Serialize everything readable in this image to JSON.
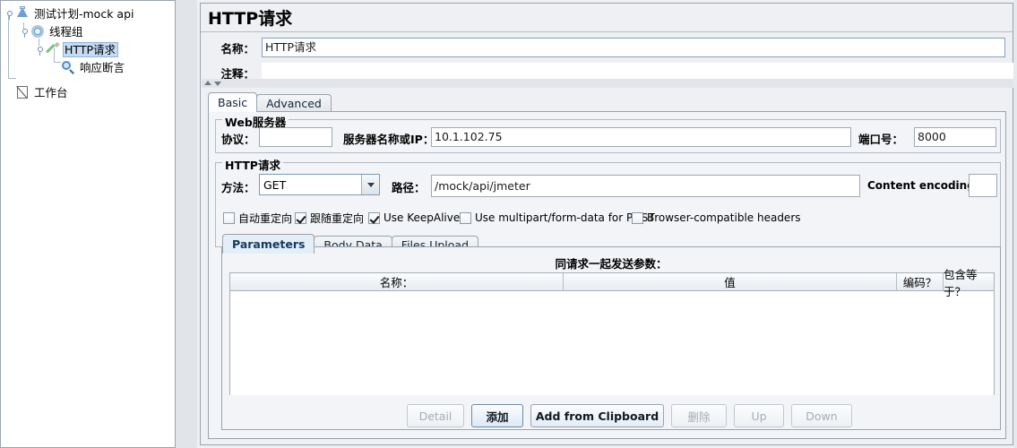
{
  "tree": {
    "nodes": [
      {
        "label": "测试计划-mock api",
        "icon": "test-plan-icon",
        "depth": 0,
        "selected": false
      },
      {
        "label": "线程组",
        "icon": "thread-group-icon",
        "depth": 1,
        "selected": false
      },
      {
        "label": "HTTP请求",
        "icon": "http-sampler-icon",
        "depth": 2,
        "selected": true
      },
      {
        "label": "响应断言",
        "icon": "assertion-magnifier-icon",
        "depth": 3,
        "selected": false
      },
      {
        "label": "工作台",
        "icon": "workbench-icon",
        "depth": 0,
        "selected": false
      }
    ]
  },
  "header": {
    "title": "HTTP请求"
  },
  "fields": {
    "name_label": "名称：",
    "name_value": "HTTP请求",
    "comment_label": "注释：",
    "comment_value": ""
  },
  "main_tabs": [
    {
      "label": "Basic",
      "active": true
    },
    {
      "label": "Advanced",
      "active": false
    }
  ],
  "web_server": {
    "group_title": "Web服务器",
    "protocol_label": "协议：",
    "protocol_value": "",
    "server_label": "服务器名称或IP：",
    "server_value": "10.1.102.75",
    "port_label": "端口号：",
    "port_value": "8000"
  },
  "http_request": {
    "group_title": "HTTP请求",
    "method_label": "方法：",
    "method_value": "GET",
    "path_label": "路径：",
    "path_value": "/mock/api/jmeter",
    "content_encoding_label": "Content encoding:",
    "content_encoding_value": ""
  },
  "checkboxes": [
    {
      "label": "自动重定向",
      "checked": false
    },
    {
      "label": "跟随重定向",
      "checked": true
    },
    {
      "label": "Use KeepAlive",
      "checked": true
    },
    {
      "label": "Use multipart/form-data for POST",
      "checked": false
    },
    {
      "label": "Browser-compatible headers",
      "checked": false
    }
  ],
  "param_tabs": [
    {
      "label": "Parameters",
      "active": true
    },
    {
      "label": "Body Data",
      "active": false
    },
    {
      "label": "Files Upload",
      "active": false
    }
  ],
  "param_table": {
    "caption": "同请求一起发送参数：",
    "columns": [
      "名称：",
      "值",
      "编码？",
      "包含等于？"
    ],
    "rows": []
  },
  "buttons": [
    {
      "label": "Detail",
      "state": "disabled"
    },
    {
      "label": "添加",
      "state": "focus"
    },
    {
      "label": "Add from Clipboard",
      "state": "primary"
    },
    {
      "label": "删除",
      "state": "disabled"
    },
    {
      "label": "Up",
      "state": "disabled"
    },
    {
      "label": "Down",
      "state": "disabled"
    }
  ],
  "colors": {
    "selection": "#c5dcf2",
    "panel_bg": "#eef0f3",
    "border": "#9aa3ad"
  }
}
